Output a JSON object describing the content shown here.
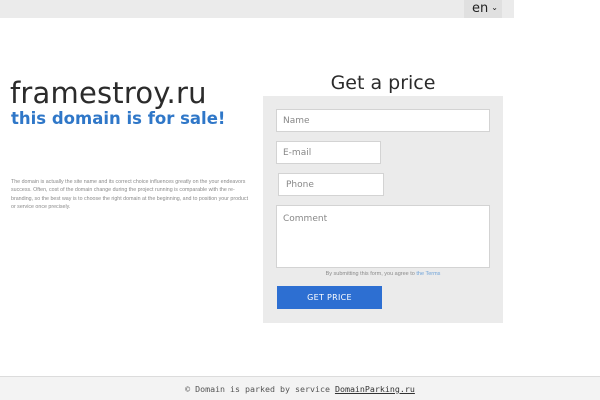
{
  "header": {
    "language": "en",
    "language_chevron_icon": "chevron-down-icon"
  },
  "domain": {
    "name": "framestroy.ru",
    "sale_text": "this domain is for sale!",
    "description": "The domain is actually the site name and its correct choice influences greatly on the your endeavors success. Often, cost of the domain change during the project running is comparable with the re-branding, so the best way is to choose the right domain at the beginning, and to position your product or service once precisely."
  },
  "form": {
    "title": "Get a price",
    "name_placeholder": "Name",
    "email_placeholder": "E-mail",
    "phone_placeholder": "Phone",
    "comment_placeholder": "Comment",
    "agree_text": "By submitting this form, you agree to",
    "terms_link": "the Terms",
    "submit_label": "GET PRICE"
  },
  "footer": {
    "text": "© Domain is parked by service",
    "link": "DomainParking.ru"
  },
  "colors": {
    "accent": "#2d6fd2",
    "sale_text": "#2f77c8",
    "panel_bg": "#ebebeb"
  }
}
